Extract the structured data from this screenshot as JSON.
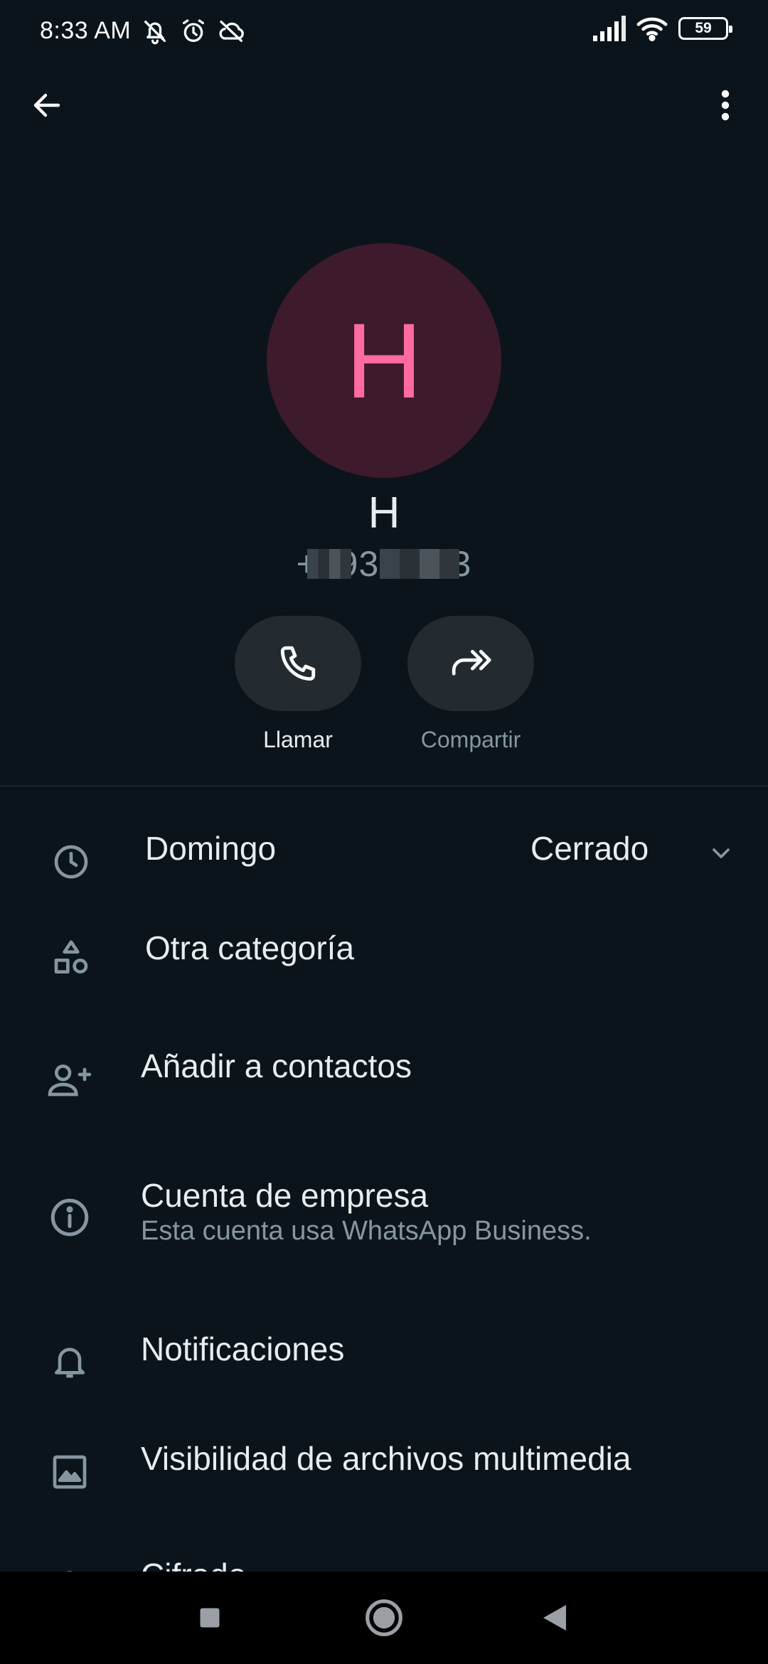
{
  "status_bar": {
    "time": "8:33 AM",
    "battery": "59",
    "icons": [
      "bell-off-icon",
      "alarm-icon",
      "cloud-off-icon",
      "signal-icon",
      "wifi-icon",
      "battery-icon"
    ]
  },
  "header": {
    "back_icon": "arrow-left-icon",
    "menu_icon": "more-vert-icon"
  },
  "profile": {
    "avatar_letter": "H",
    "name": "H",
    "phone": "+593        2403",
    "avatar_bg": "#3d1a2c",
    "avatar_fg": "#ff6aa3"
  },
  "actions": [
    {
      "label": "Llamar",
      "icon": "phone-icon"
    },
    {
      "label": "Compartir",
      "icon": "share-icon"
    }
  ],
  "hours": {
    "day": "Domingo",
    "status": "Cerrado"
  },
  "rows": {
    "category": "Otra categoría",
    "add_contact": "Añadir a contactos",
    "business_title": "Cuenta de empresa",
    "business_sub": "Esta cuenta usa WhatsApp Business.",
    "notifications": "Notificaciones",
    "media_visibility": "Visibilidad de archivos multimedia",
    "encryption": "Cifrado"
  },
  "colors": {
    "background": "#0b141a",
    "text_primary": "#e9edef",
    "text_secondary": "#8696a0",
    "button_bg": "#242b30"
  }
}
